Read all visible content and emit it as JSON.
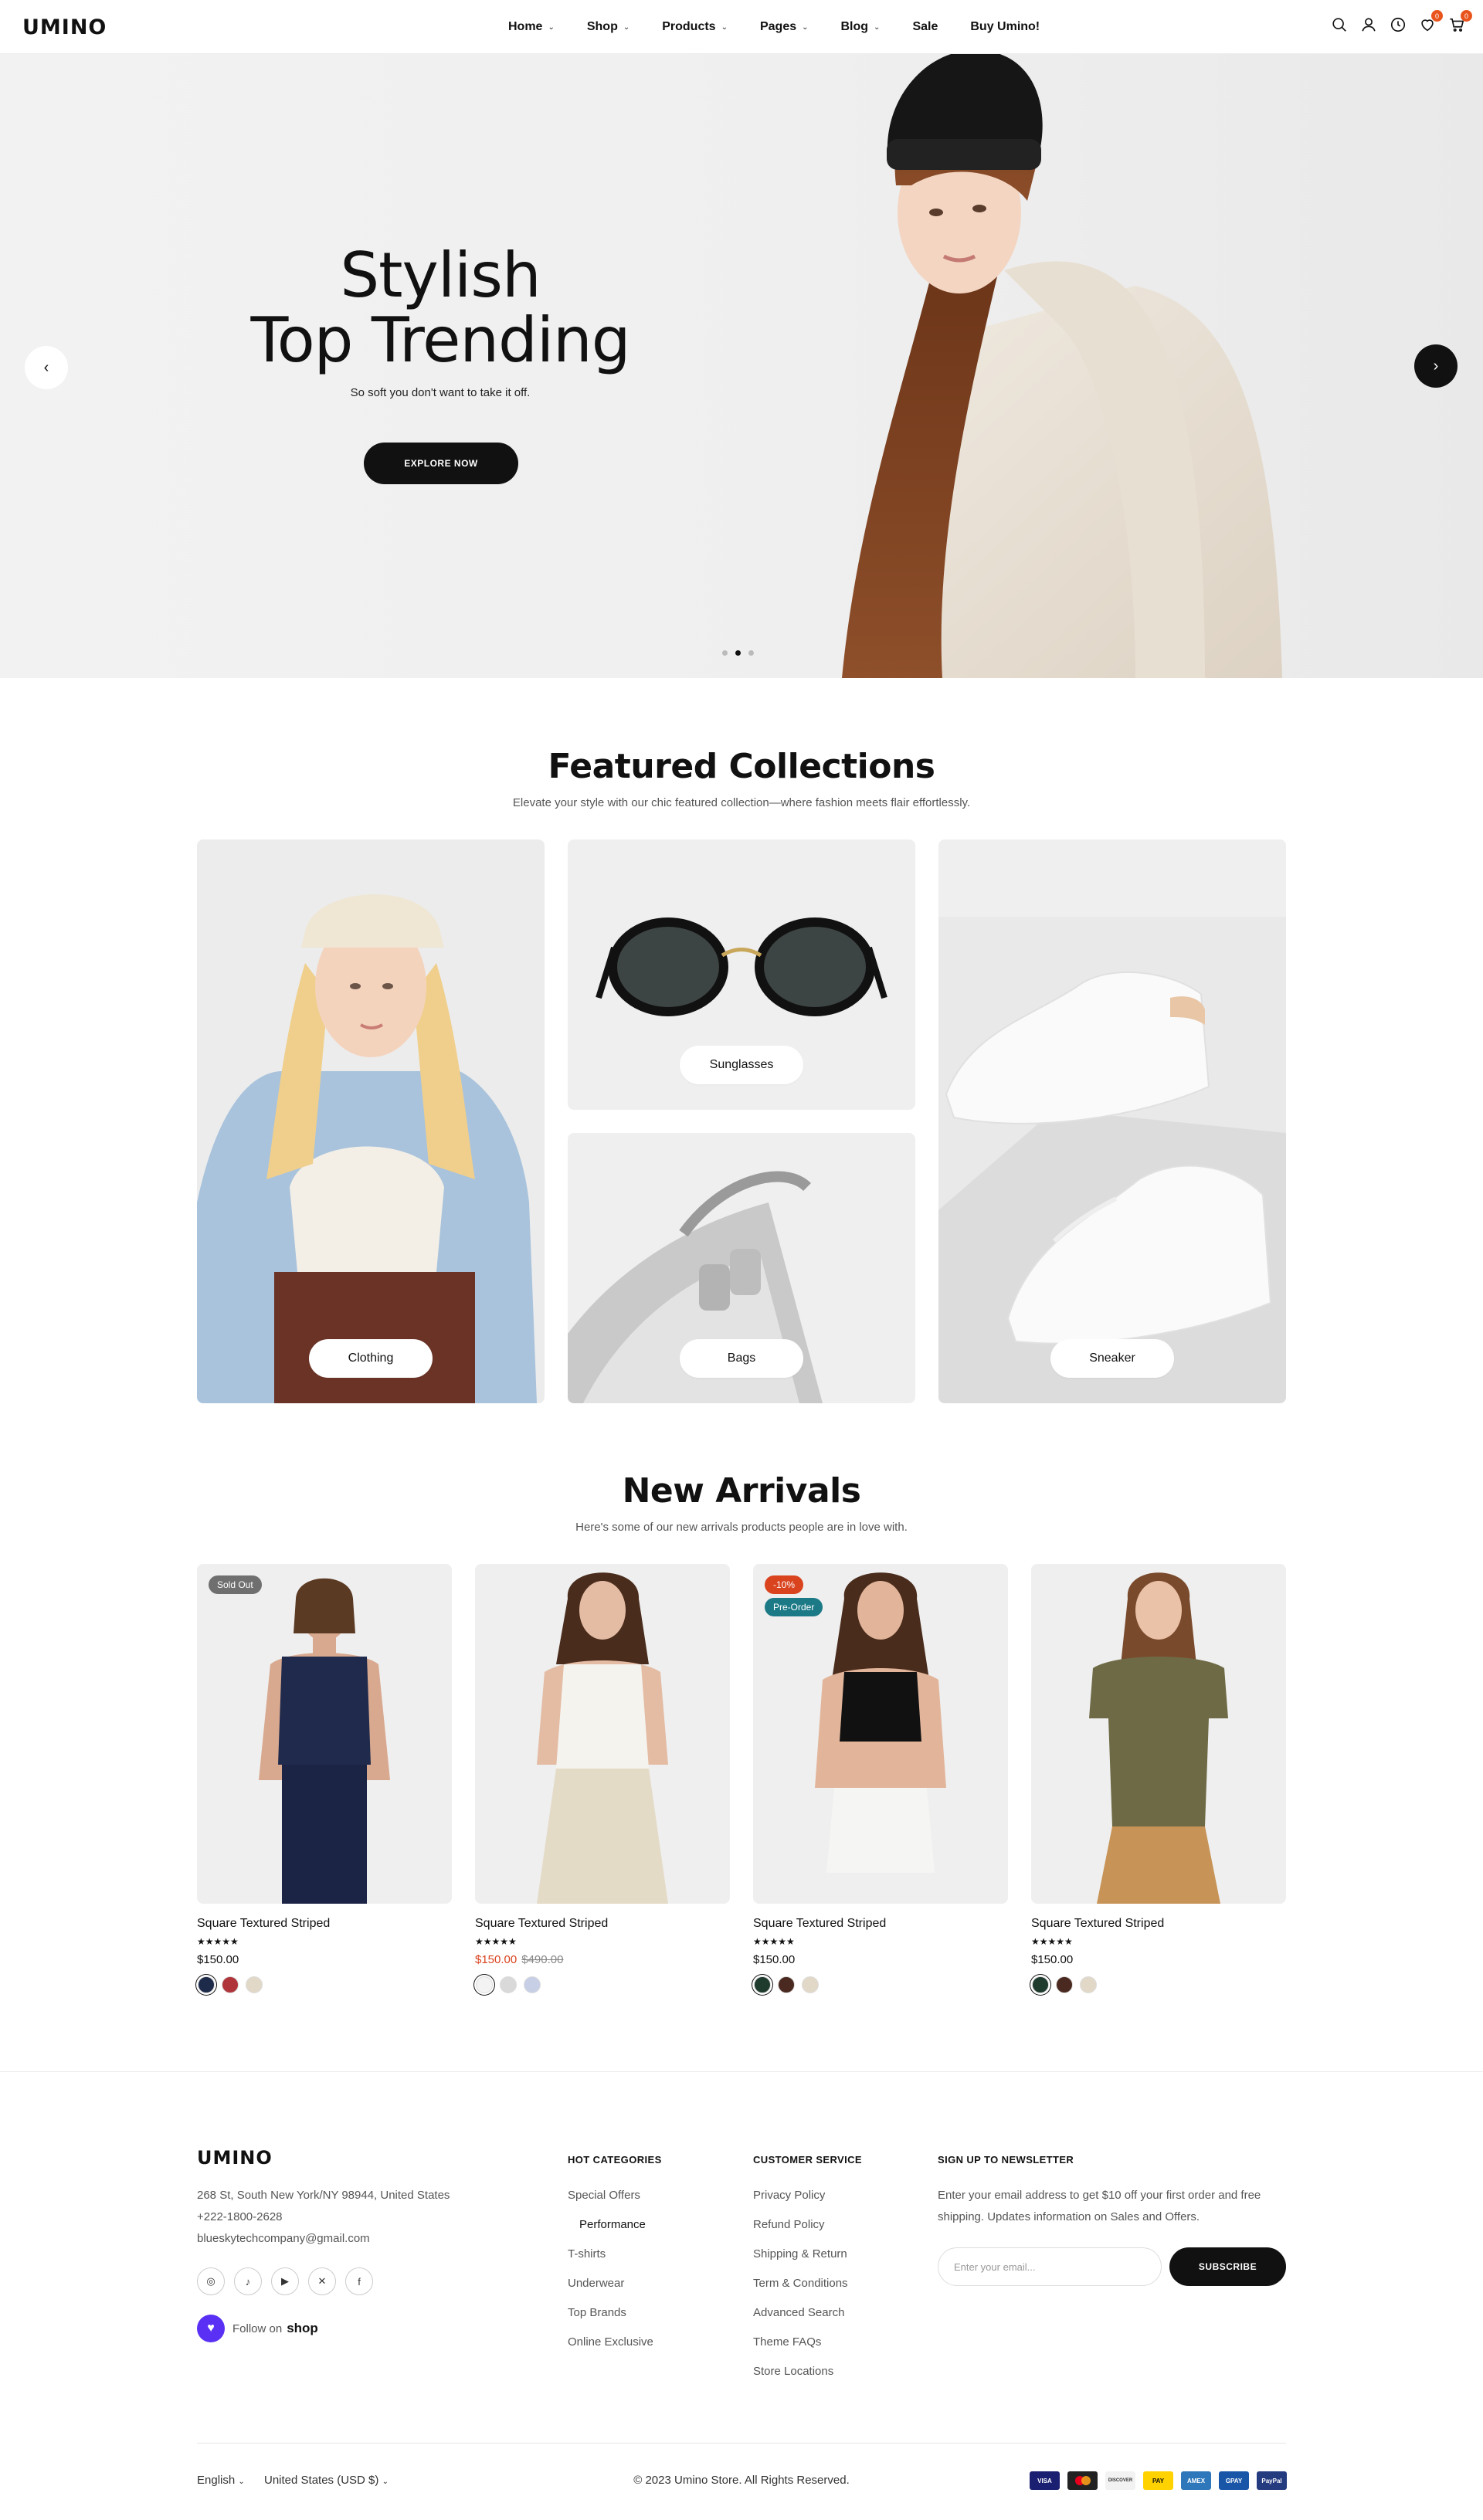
{
  "header": {
    "logo": "UMINO",
    "nav": [
      {
        "label": "Home",
        "has_dropdown": true
      },
      {
        "label": "Shop",
        "has_dropdown": true
      },
      {
        "label": "Products",
        "has_dropdown": true
      },
      {
        "label": "Pages",
        "has_dropdown": true
      },
      {
        "label": "Blog",
        "has_dropdown": true
      },
      {
        "label": "Sale",
        "has_dropdown": false
      },
      {
        "label": "Buy Umino!",
        "has_dropdown": false
      }
    ],
    "icons": [
      "search-icon",
      "user-icon",
      "clock-icon",
      "heart-icon",
      "cart-icon"
    ],
    "wishlist_count": "0",
    "cart_count": "0"
  },
  "hero": {
    "title_line1": "Stylish",
    "title_line2": "Top Trending",
    "subtitle": "So soft you don't want to take it off.",
    "button": "EXPLORE NOW",
    "prev_arrow": "‹",
    "next_arrow": "›",
    "slides": 3,
    "active_slide": 2
  },
  "featured": {
    "title": "Featured Collections",
    "subtitle": "Elevate your style with our chic featured collection—where fashion meets flair effortlessly.",
    "items": [
      {
        "label": "Clothing"
      },
      {
        "label": "Sunglasses"
      },
      {
        "label": "Bags"
      },
      {
        "label": "Sneaker"
      }
    ]
  },
  "arrivals": {
    "title": "New Arrivals",
    "subtitle": "Here's some of our new arrivals products people are in love with.",
    "products": [
      {
        "name": "Square Textured Striped",
        "rating": "★★★★★",
        "price": "$150.00",
        "old_price": "",
        "tags": [
          "Sold Out"
        ],
        "swatches": [
          "#1e2a4a",
          "#b0353b",
          "#e2d8c8"
        ]
      },
      {
        "name": "Square Textured Striped",
        "rating": "★★★★★",
        "price": "$150.00",
        "old_price": "$490.00",
        "tags": [],
        "swatches": [
          "#f3f3f3",
          "#d9d9d9",
          "#c7cfe6"
        ]
      },
      {
        "name": "Square Textured Striped",
        "rating": "★★★★★",
        "price": "$150.00",
        "old_price": "",
        "tags": [
          "-10%",
          "Pre-Order"
        ],
        "swatches": [
          "#1f3b2e",
          "#4a2a20",
          "#e2d8c8"
        ]
      },
      {
        "name": "Square Textured Striped",
        "rating": "★★★★★",
        "price": "$150.00",
        "old_price": "",
        "tags": [],
        "swatches": [
          "#1f3b2e",
          "#4a2a20",
          "#e2d8c8"
        ]
      }
    ]
  },
  "footer": {
    "logo": "UMINO",
    "address": "268 St, South New York/NY 98944, United States",
    "phone": "+222-1800-2628",
    "email": "blueskytechcompany@gmail.com",
    "social": [
      "instagram-icon",
      "tiktok-icon",
      "youtube-icon",
      "x-icon",
      "facebook-icon"
    ],
    "follow_text": "Follow on",
    "follow_brand": "shop",
    "hot_categories": {
      "heading": "HOT CATEGORIES",
      "links": [
        "Special Offers",
        "Performance",
        "T-shirts",
        "Underwear",
        "Top Brands",
        "Online Exclusive"
      ]
    },
    "customer_service": {
      "heading": "CUSTOMER SERVICE",
      "links": [
        "Privacy Policy",
        "Refund Policy",
        "Shipping & Return",
        "Term & Conditions",
        "Advanced Search",
        "Theme FAQs",
        "Store Locations"
      ]
    },
    "newsletter": {
      "heading": "SIGN UP TO NEWSLETTER",
      "text_line1": "Enter your email address to get $10 off your first order and free",
      "text_line2": "shipping. Updates information on Sales and Offers.",
      "placeholder": "Enter your email...",
      "button": "SUBSCRIBE"
    },
    "language": "English",
    "currency": "United States (USD $)",
    "copyright": "© 2023 Umino Store. All Rights Reserved.",
    "payments": [
      {
        "name": "VISA",
        "color": "#1a1f71"
      },
      {
        "name": "MC",
        "color": "#222"
      },
      {
        "name": "DISCOVER",
        "color": "#f2f2f2"
      },
      {
        "name": "PAY",
        "color": "#ffd200"
      },
      {
        "name": "AMEX",
        "color": "#2e77bb"
      },
      {
        "name": "GPAY",
        "color": "#1a56a8"
      },
      {
        "name": "PayPal",
        "color": "#253b80"
      }
    ]
  }
}
